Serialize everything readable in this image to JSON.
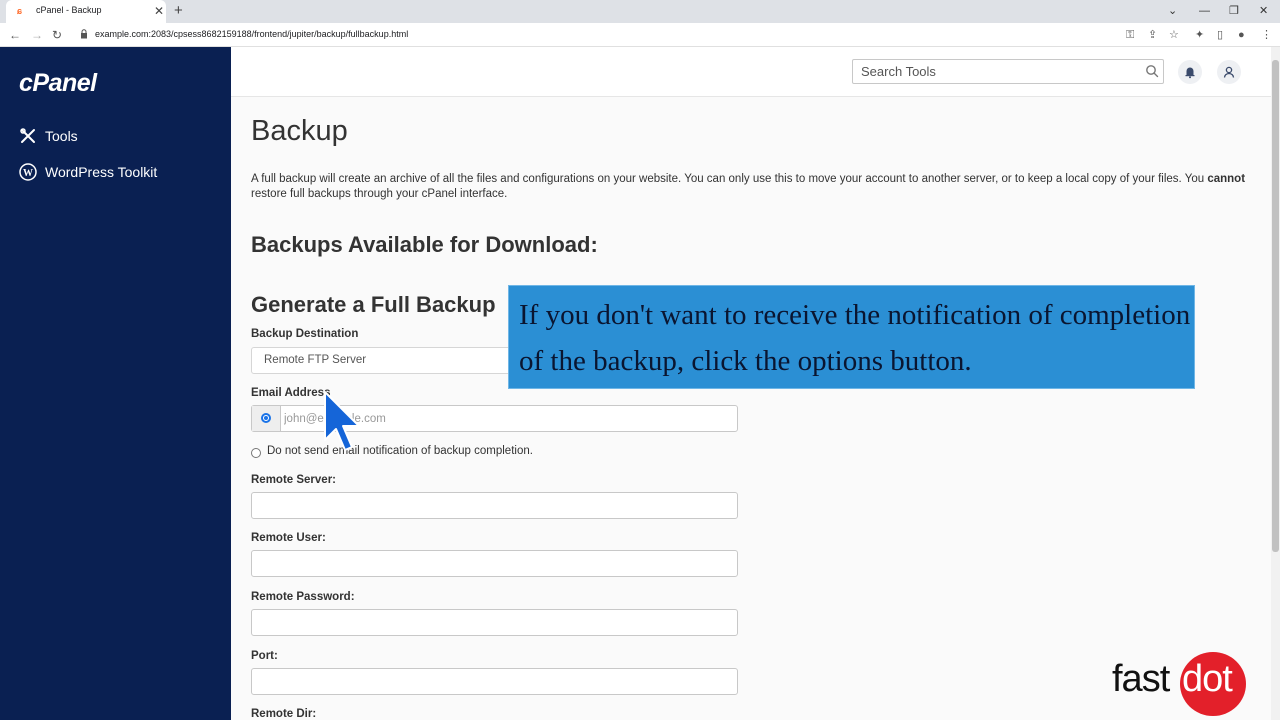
{
  "browser": {
    "tab_title": "cPanel - Backup",
    "tab_close": "✕",
    "new_tab": "+",
    "url": "example.com:2083/cpsess8682159188/frontend/jupiter/backup/fullbackup.html"
  },
  "sidebar": {
    "logo": "cPanel",
    "items": [
      {
        "label": "Tools",
        "icon": "tools-icon"
      },
      {
        "label": "WordPress Toolkit",
        "icon": "wordpress-icon"
      }
    ]
  },
  "header": {
    "search_placeholder": "Search Tools"
  },
  "main": {
    "title": "Backup",
    "description_1": "A full backup will create an archive of all the files and configurations on your website. You can only use this to move your account to another server, or to keep a local copy of your files. You ",
    "description_bold": "cannot",
    "description_2": " restore full backups through your cPanel interface.",
    "available_heading": "Backups Available for Download:",
    "generate_heading": "Generate a Full Backup",
    "backup_destination_label": "Backup Destination",
    "backup_destination_value": "Remote FTP Server",
    "email_label": "Email Address",
    "email_placeholder": "john@example.com",
    "no_email_label": "Do not send email notification of backup completion.",
    "remote_server_label": "Remote Server:",
    "remote_user_label": "Remote User:",
    "remote_password_label": "Remote Password:",
    "port_label": "Port:",
    "remote_dir_label": "Remote Dir:"
  },
  "overlay": {
    "callout": "If you don't want to receive the notification of completion of the backup, click the options button."
  },
  "watermark": {
    "brand_left": "fast",
    "brand_right": "dot",
    "brand_color": "#e3202a"
  },
  "colors": {
    "sidebar_bg": "#0a2052",
    "callout_bg": "#2b8fd4",
    "radio_accent": "#1a73e8"
  }
}
